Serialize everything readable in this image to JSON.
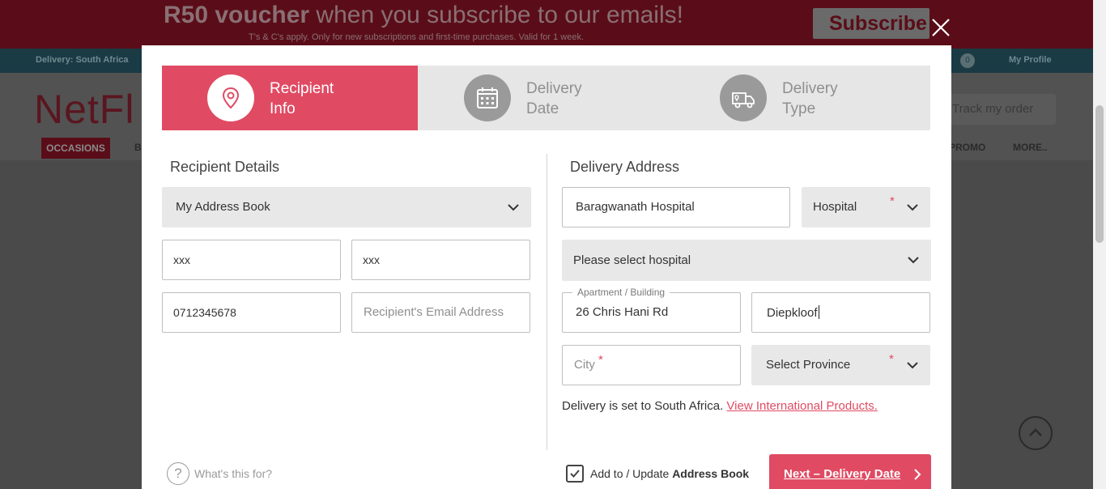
{
  "background": {
    "promo": {
      "headline_bold": "R50 voucher",
      "headline_rest": " when you subscribe to our emails!",
      "subtext": "T's & C's apply. Only for new subscriptions and first-time purchases. Valid for 1 week.",
      "subscribe_label": "Subscribe"
    },
    "topbar": {
      "delivery": "Delivery: South Africa",
      "cart_count": "0",
      "profile": "My Profile"
    },
    "logo": "NetFl",
    "track_label": "Track my order",
    "nav": {
      "occasions": "OCCASIONS",
      "b_partial": "B",
      "promo": "PROMO",
      "more": "MORE.."
    }
  },
  "steps": [
    {
      "line1": "Recipient",
      "line2": "Info",
      "icon": "location-pin-icon",
      "active": true
    },
    {
      "line1": "Delivery",
      "line2": "Date",
      "icon": "calendar-icon",
      "active": false
    },
    {
      "line1": "Delivery",
      "line2": "Type",
      "icon": "truck-icon",
      "active": false
    }
  ],
  "recipient": {
    "title": "Recipient Details",
    "address_book": "My Address Book",
    "first_name": "xxx",
    "last_name": "xxx",
    "phone": "0712345678",
    "email_placeholder": "Recipient's Email Address"
  },
  "address": {
    "title": "Delivery Address",
    "place_name": "Baragwanath Hospital",
    "place_type": "Hospital",
    "hospital_select": "Please select hospital",
    "apartment_label": "Apartment / Building",
    "apartment_value": "26 Chris Hani Rd",
    "suburb_value": "Diepkloof",
    "city_placeholder": "City",
    "province_select": "Select Province",
    "required_mark": "*"
  },
  "delivery_note": {
    "text": "Delivery is set to South Africa. ",
    "link": "View International Products."
  },
  "footer": {
    "help_text": "What's this for?",
    "help_symbol": "?",
    "checkbox_label": "Add to / Update ",
    "checkbox_label_bold": "Address Book",
    "checkbox_checked": true,
    "next_label": "Next – Delivery Date"
  },
  "colors": {
    "accent": "#e04b63",
    "step_inactive_bg": "#e6e6e6",
    "select_bg": "#e8e8e8"
  }
}
